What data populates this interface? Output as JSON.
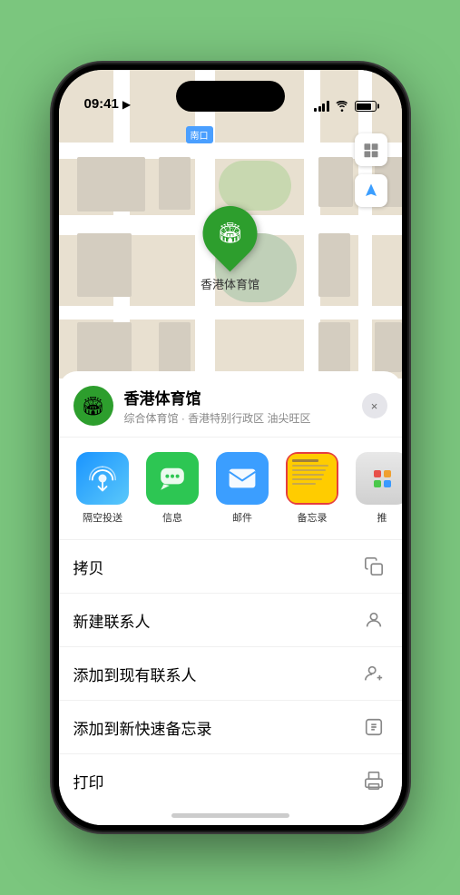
{
  "status_bar": {
    "time": "09:41",
    "location_arrow": "▶"
  },
  "map": {
    "label_text": "南口",
    "pin_name": "香港体育馆"
  },
  "sheet": {
    "venue_name": "香港体育馆",
    "venue_subtitle": "综合体育馆 · 香港特别行政区 油尖旺区",
    "close_label": "×"
  },
  "share_items": [
    {
      "id": "airdrop",
      "label": "隔空投送",
      "icon": "📡"
    },
    {
      "id": "messages",
      "label": "信息",
      "icon": "💬"
    },
    {
      "id": "mail",
      "label": "邮件",
      "icon": "✉️"
    },
    {
      "id": "notes",
      "label": "备忘录",
      "icon": ""
    },
    {
      "id": "more",
      "label": "推",
      "icon": ""
    }
  ],
  "actions": [
    {
      "id": "copy",
      "label": "拷贝",
      "icon": "⎘"
    },
    {
      "id": "new-contact",
      "label": "新建联系人",
      "icon": "👤"
    },
    {
      "id": "add-contact",
      "label": "添加到现有联系人",
      "icon": "👤"
    },
    {
      "id": "quick-note",
      "label": "添加到新快速备忘录",
      "icon": "⊞"
    },
    {
      "id": "print",
      "label": "打印",
      "icon": "🖨"
    }
  ]
}
